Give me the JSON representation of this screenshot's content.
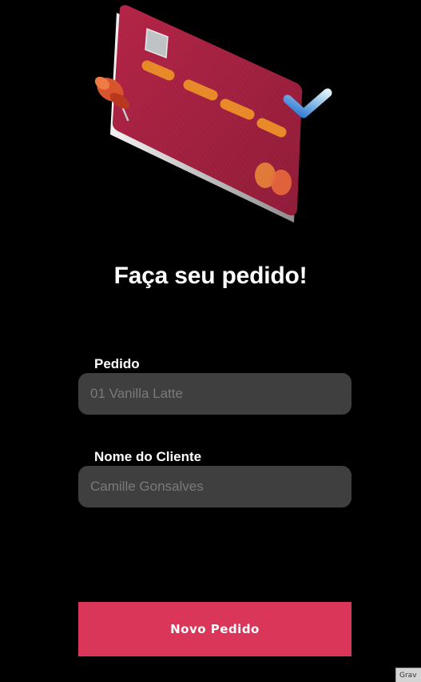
{
  "header": {
    "title": "Faça seu pedido!"
  },
  "form": {
    "order_label": "Pedido",
    "order_placeholder": "01 Vanilla Latte",
    "client_label": "Nome do Cliente",
    "client_placeholder": "Camille Gonsalves",
    "submit_label": "Novo Pedido"
  },
  "corner_tag": {
    "text": "Grav"
  },
  "colors": {
    "background": "#000000",
    "input_background": "#3f3f3f",
    "accent": "#d9365a",
    "card": "#a3213f",
    "card_stripe": "#e88a2a"
  },
  "hero_illustration": {
    "icons": [
      "credit-card-icon",
      "pushpin-icon",
      "checkmark-icon"
    ]
  }
}
